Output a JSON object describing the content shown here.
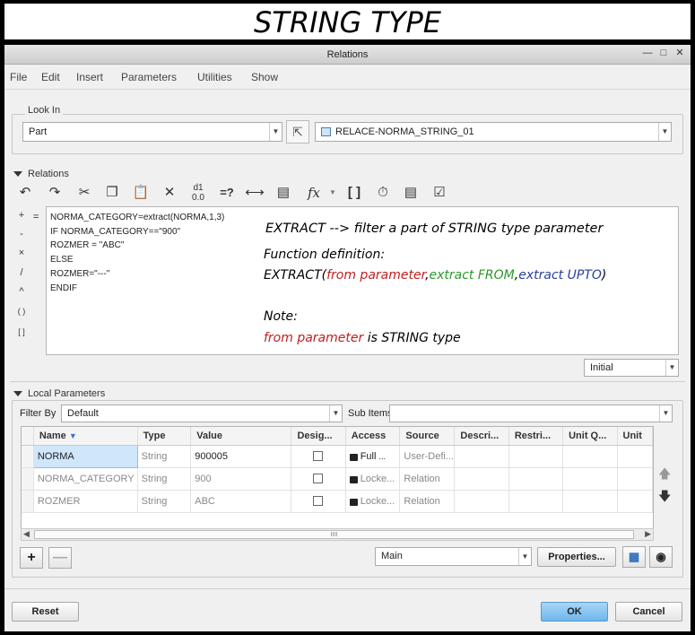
{
  "banner": {
    "title": "STRING TYPE"
  },
  "window": {
    "title": "Relations"
  },
  "menu": [
    "File",
    "Edit",
    "Insert",
    "Parameters",
    "Utilities",
    "Show"
  ],
  "look_in": {
    "label": "Look In",
    "type_value": "Part",
    "object_value": "RELACE-NORMA_STRING_01"
  },
  "relations": {
    "label": "Relations",
    "lines": [
      "NORMA_CATEGORY=extract(NORMA,1,3)",
      "IF NORMA_CATEGORY==\"900\"",
      "ROZMER = \"ABC\"",
      "ELSE",
      "ROZMER=\"---\"",
      "ENDIF"
    ],
    "operators": [
      "+",
      "-",
      "×",
      "/",
      "^",
      "( )",
      "[ ]"
    ],
    "equals": "=",
    "units_value": "Initial"
  },
  "annotation": {
    "line1": "EXTRACT --> filter a part of STRING type parameter",
    "line2": "Function definition:",
    "fn_name": "EXTRACT(",
    "fn_arg1": "from parameter",
    "comma1": ",",
    "fn_arg2": "extract FROM",
    "comma2": ",",
    "fn_arg3": "extract UPTO",
    "fn_close": ")",
    "note_label": "Note:",
    "note_red": "from parameter",
    "note_rest": " is STRING type"
  },
  "local_params": {
    "label": "Local Parameters",
    "filter_label": "Filter By",
    "filter_value": "Default",
    "subitems_label": "Sub Items",
    "columns": [
      "Name",
      "Type",
      "Value",
      "Desig...",
      "Access",
      "Source",
      "Descri...",
      "Restri...",
      "Unit Q...",
      "Unit"
    ],
    "rows": [
      {
        "name": "NORMA",
        "type": "String",
        "value": "900005",
        "access": "Full",
        "source": "User-Defi..."
      },
      {
        "name": "NORMA_CATEGORY",
        "type": "String",
        "value": "900",
        "access": "Locke...",
        "source": "Relation"
      },
      {
        "name": "ROZMER",
        "type": "String",
        "value": "ABC",
        "access": "Locke...",
        "source": "Relation"
      }
    ],
    "scroll_grip": "IIII",
    "view_value": "Main",
    "properties_label": "Properties..."
  },
  "footer": {
    "reset": "Reset",
    "ok": "OK",
    "cancel": "Cancel"
  },
  "colors": {
    "accent": "#6fb6ec",
    "selected_row": "#cfe6fb"
  }
}
